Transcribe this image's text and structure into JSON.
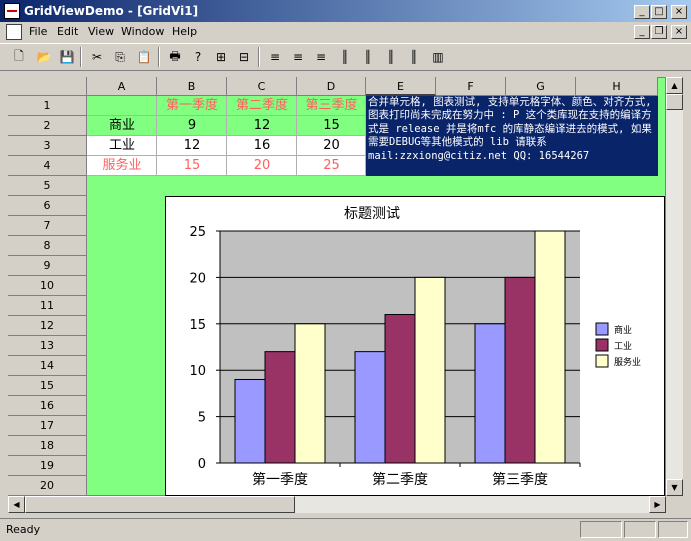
{
  "window": {
    "title": "GridViewDemo - [GridVi1]",
    "min": "_",
    "max": "□",
    "close": "×"
  },
  "menu": {
    "items": [
      "File",
      "Edit",
      "View",
      "Window",
      "Help"
    ],
    "doc_min": "_",
    "doc_restore": "❐",
    "doc_close": "×"
  },
  "toolbar": {
    "icons": [
      "new-icon",
      "open-icon",
      "save-icon",
      "cut-icon",
      "copy-icon",
      "paste-icon",
      "print-icon",
      "help-icon",
      "merge-cells-icon",
      "split-cells-icon",
      "align-left-icon",
      "align-center-icon",
      "align-right-icon",
      "barcode1-icon",
      "barcode2-icon",
      "barcode3-icon",
      "barcode4-icon",
      "bar-chart-icon"
    ]
  },
  "grid": {
    "columns": [
      "A",
      "B",
      "C",
      "D",
      "E",
      "F",
      "G",
      "H"
    ],
    "rows": [
      "1",
      "2",
      "3",
      "4",
      "5",
      "6",
      "7",
      "8",
      "9",
      "10",
      "11",
      "12",
      "13",
      "14",
      "15",
      "16",
      "17",
      "18",
      "19",
      "20"
    ],
    "cells": [
      {
        "row": 1,
        "col": 1,
        "text": "第一季度",
        "color": "#ff6060"
      },
      {
        "row": 1,
        "col": 2,
        "text": "第二季度",
        "color": "#ff6060"
      },
      {
        "row": 1,
        "col": 3,
        "text": "第三季度",
        "color": "#ff6060"
      },
      {
        "row": 2,
        "col": 0,
        "text": "商业",
        "color": "#000000"
      },
      {
        "row": 2,
        "col": 1,
        "text": "9",
        "color": "#000000"
      },
      {
        "row": 2,
        "col": 2,
        "text": "12",
        "color": "#000000"
      },
      {
        "row": 2,
        "col": 3,
        "text": "15",
        "color": "#000000"
      },
      {
        "row": 3,
        "col": 0,
        "text": "工业",
        "color": "#000000"
      },
      {
        "row": 3,
        "col": 1,
        "text": "12",
        "color": "#000000"
      },
      {
        "row": 3,
        "col": 2,
        "text": "16",
        "color": "#000000"
      },
      {
        "row": 3,
        "col": 3,
        "text": "20",
        "color": "#000000"
      },
      {
        "row": 4,
        "col": 0,
        "text": "服务业",
        "color": "#ff6060"
      },
      {
        "row": 4,
        "col": 1,
        "text": "15",
        "color": "#ff6060"
      },
      {
        "row": 4,
        "col": 2,
        "text": "20",
        "color": "#ff6060"
      },
      {
        "row": 4,
        "col": 3,
        "text": "25",
        "color": "#ff6060"
      }
    ],
    "merged_text": "合并单元格, 图表测试, 支持单元格字体、颜色、对齐方式, 图表打印尚未完成在努力中 : P   这个类库现在支持的编译方式是 release 并是将mfc 的库静态编译进去的模式, 如果需要DEBUG等其他模式的 lib 请联系mail:zzxiong@citiz.net QQ: 16544267"
  },
  "chart_data": {
    "type": "bar",
    "title": "标题测试",
    "categories": [
      "第一季度",
      "第二季度",
      "第三季度"
    ],
    "series": [
      {
        "name": "商业",
        "values": [
          9,
          12,
          15
        ],
        "color": "#9999ff"
      },
      {
        "name": "工业",
        "values": [
          12,
          16,
          20
        ],
        "color": "#993366"
      },
      {
        "name": "服务业",
        "values": [
          15,
          20,
          25
        ],
        "color": "#ffffcc"
      }
    ],
    "yticks": [
      "0",
      "5",
      "10",
      "15",
      "20",
      "25"
    ],
    "ylim": [
      0,
      25
    ],
    "grid": true,
    "legend": "right"
  },
  "status": {
    "text": "Ready"
  }
}
